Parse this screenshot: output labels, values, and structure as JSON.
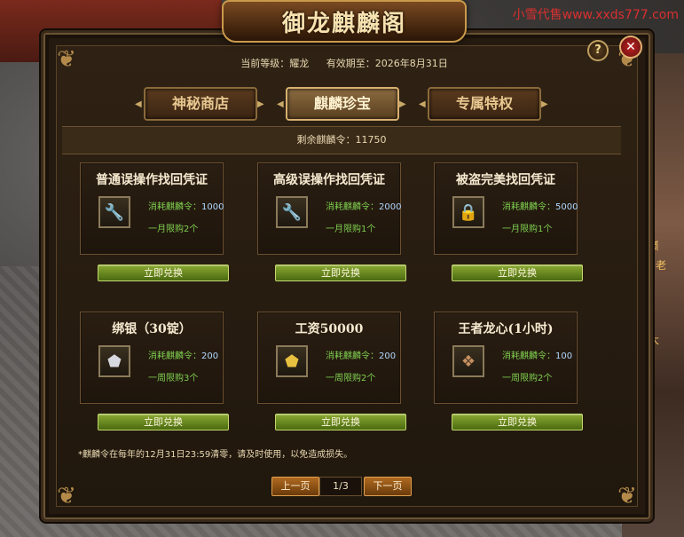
{
  "watermark": "小雪代售www.xxds777.com",
  "window": {
    "title": "御龙麒麟阁",
    "help": "?",
    "close": "✕"
  },
  "info": {
    "level_label": "当前等级：",
    "level_value": "耀龙",
    "valid_label": "有效期至：",
    "valid_value": "2026年8月31日"
  },
  "tabs": [
    {
      "label": "神秘商店"
    },
    {
      "label": "麒麟珍宝"
    },
    {
      "label": "专属特权"
    }
  ],
  "remaining": {
    "label": "剩余麒麟令：",
    "value": "11750"
  },
  "cards": [
    {
      "title": "普通误操作找回凭证",
      "cost_label": "消耗麒麟令：",
      "cost": "1000",
      "limit": "一月限购2个",
      "button": "立即兑换",
      "icon": "wrench-icon"
    },
    {
      "title": "高级误操作找回凭证",
      "cost_label": "消耗麒麟令：",
      "cost": "2000",
      "limit": "一月限购1个",
      "button": "立即兑换",
      "icon": "wrench-icon"
    },
    {
      "title": "被盗完美找回凭证",
      "cost_label": "消耗麒麟令：",
      "cost": "5000",
      "limit": "一月限购1个",
      "button": "立即兑换",
      "icon": "lock-chest-icon"
    },
    {
      "title": "绑银（30锭）",
      "cost_label": "消耗麒麟令：",
      "cost": "200",
      "limit": "一周限购3个",
      "button": "立即兑换",
      "icon": "silver-ingot-icon"
    },
    {
      "title": "工资50000",
      "cost_label": "消耗麒麟令：",
      "cost": "200",
      "limit": "一周限购2个",
      "button": "立即兑换",
      "icon": "gold-ingot-icon"
    },
    {
      "title": "王者龙心(1小时)",
      "cost_label": "消耗麒麟令：",
      "cost": "100",
      "limit": "一周限购2个",
      "button": "立即兑换",
      "icon": "dragon-heart-icon"
    }
  ],
  "notice": "*麒麟令在每年的12月31日23:59清零，请及时使用，以免造成损失。",
  "pagination": {
    "prev": "上一页",
    "page": "1/3",
    "next": "下一页"
  },
  "background_text": [
    "年 · 巅",
    "ecc · 老",
    "消费大"
  ]
}
